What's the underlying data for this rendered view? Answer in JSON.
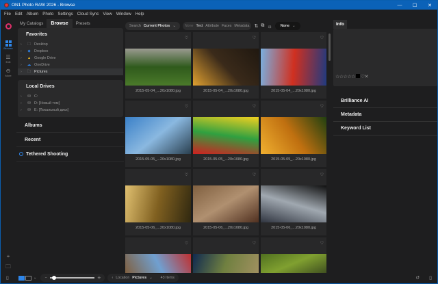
{
  "window": {
    "title": "ON1 Photo RAW 2026 - Browse",
    "controls": [
      "—",
      "☐",
      "✕"
    ]
  },
  "menu": [
    "File",
    "Edit",
    "Album",
    "Photo",
    "Settings",
    "Cloud Sync",
    "View",
    "Window",
    "Help"
  ],
  "modules": [
    {
      "label": "Browse",
      "icon": "grid-icon",
      "active": true
    },
    {
      "label": "Edit",
      "icon": "sliders-icon"
    },
    {
      "label": "More",
      "icon": "more-icon"
    }
  ],
  "left": {
    "tabs": [
      "My Catalogs",
      "Browse",
      "Presets"
    ],
    "active_tab": "Browse",
    "favorites": {
      "title": "Favorites",
      "items": [
        {
          "label": "Desktop",
          "icon": "folder-icon"
        },
        {
          "label": "Dropbox",
          "icon": "dropbox-icon"
        },
        {
          "label": "Google Drive",
          "icon": "google-drive-icon"
        },
        {
          "label": "OneDrive",
          "icon": "onedrive-icon"
        },
        {
          "label": "Pictures",
          "icon": "folder-icon",
          "selected": true
        }
      ]
    },
    "drives": {
      "title": "Local Drives",
      "items": [
        {
          "label": "C:"
        },
        {
          "label": "D: [Новый том]"
        },
        {
          "label": "E: [Локальный диск]"
        }
      ]
    },
    "albums": "Albums",
    "recent": "Recent",
    "tethered": "Tethered Shooting"
  },
  "toolbar": {
    "search_label": "Search",
    "search_value": "Current Photos",
    "filters": [
      "None",
      "Text",
      "Attribute",
      "Faces",
      "Metadata"
    ],
    "sort_value": "None"
  },
  "grid": {
    "items": [
      {
        "name": "2015-05-04_...20x1080.jpg",
        "colors": [
          "#4a7a2a",
          "#2f5a1c",
          "#9a9a90"
        ]
      },
      {
        "name": "2015-05-04_...20x1080.jpg",
        "colors": [
          "#e0a030",
          "#3a2a1a",
          "#201810"
        ]
      },
      {
        "name": "2015-05-04_...20x1080.jpg",
        "colors": [
          "#7ab0e0",
          "#d03020",
          "#203a80"
        ]
      },
      {
        "name": "2015-05-05_...20x1080.jpg",
        "colors": [
          "#3a80c8",
          "#8ab8e0",
          "#2a4050"
        ]
      },
      {
        "name": "2015-05-05_...20x1080.jpg",
        "colors": [
          "#d02020",
          "#30a040",
          "#f0d020"
        ]
      },
      {
        "name": "2015-05-05_...20x1080.jpg",
        "colors": [
          "#f0b030",
          "#c07010",
          "#204010"
        ]
      },
      {
        "name": "2015-05-06_...20x1080.jpg",
        "colors": [
          "#e0c070",
          "#806020",
          "#302810"
        ]
      },
      {
        "name": "2015-05-06_...20x1080.jpg",
        "colors": [
          "#806040",
          "#b09070",
          "#503020"
        ]
      },
      {
        "name": "2015-05-06_...20x1080.jpg",
        "colors": [
          "#303540",
          "#a0a8b0",
          "#101010"
        ]
      },
      {
        "name": "",
        "colors": [
          "#806040",
          "#70a0d0",
          "#c03030"
        ]
      },
      {
        "name": "",
        "colors": [
          "#102a50",
          "#708040",
          "#a09060"
        ]
      },
      {
        "name": "",
        "colors": [
          "#507020",
          "#80a030",
          "#405020"
        ]
      }
    ]
  },
  "info": {
    "tab": "Info",
    "rating": "☆☆☆☆☆",
    "sections": [
      "Brilliance AI",
      "Metadata",
      "Keyword List"
    ]
  },
  "bottom": {
    "location_label": "Location",
    "location_value": "Pictures",
    "count": "43 Items",
    "zoom_fraction": 0.05
  }
}
